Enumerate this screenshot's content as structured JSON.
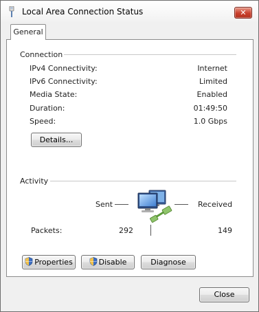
{
  "window": {
    "title": "Local Area Connection Status",
    "close_label": "✕"
  },
  "tabs": [
    {
      "label": "General"
    }
  ],
  "connection": {
    "section_label": "Connection",
    "rows": [
      {
        "label": "IPv4 Connectivity:",
        "value": "Internet"
      },
      {
        "label": "IPv6 Connectivity:",
        "value": "Limited"
      },
      {
        "label": "Media State:",
        "value": "Enabled"
      },
      {
        "label": "Duration:",
        "value": "01:49:50"
      },
      {
        "label": "Speed:",
        "value": "1.0 Gbps"
      }
    ],
    "details_button": "Details..."
  },
  "activity": {
    "section_label": "Activity",
    "sent_label": "Sent",
    "received_label": "Received",
    "packets_label": "Packets:",
    "packets_sent": "292",
    "packets_received": "149",
    "icon": "network-computers-icon"
  },
  "buttons": {
    "properties": "Properties",
    "disable": "Disable",
    "diagnose": "Diagnose",
    "close": "Close"
  }
}
